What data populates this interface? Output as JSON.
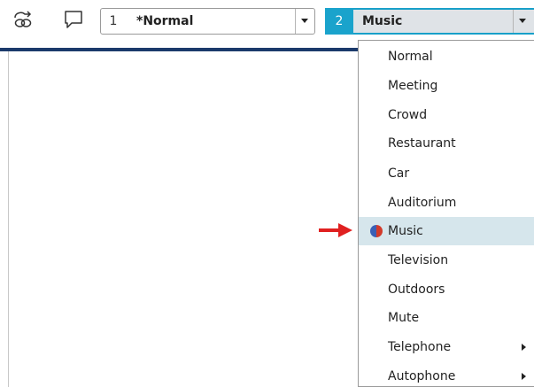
{
  "toolbar": {
    "icons": [
      "link-icon",
      "comment-icon"
    ],
    "program1": {
      "number": "1",
      "name": "*Normal"
    },
    "program2": {
      "number": "2",
      "name": "Music"
    }
  },
  "menu": {
    "items": [
      {
        "label": "Normal"
      },
      {
        "label": "Meeting"
      },
      {
        "label": "Crowd"
      },
      {
        "label": "Restaurant"
      },
      {
        "label": "Car"
      },
      {
        "label": "Auditorium"
      },
      {
        "label": "Music",
        "selected": true,
        "icon": "half-circle-icon"
      },
      {
        "label": "Television"
      },
      {
        "label": "Outdoors"
      },
      {
        "label": "Mute"
      },
      {
        "label": "Telephone",
        "submenu": true
      },
      {
        "label": "Autophone",
        "submenu": true
      }
    ]
  },
  "colors": {
    "accent": "#1aa3cc",
    "selected_bg": "#d6e6ec",
    "pointer_arrow": "#e02020",
    "divider": "#1b3a6b"
  }
}
